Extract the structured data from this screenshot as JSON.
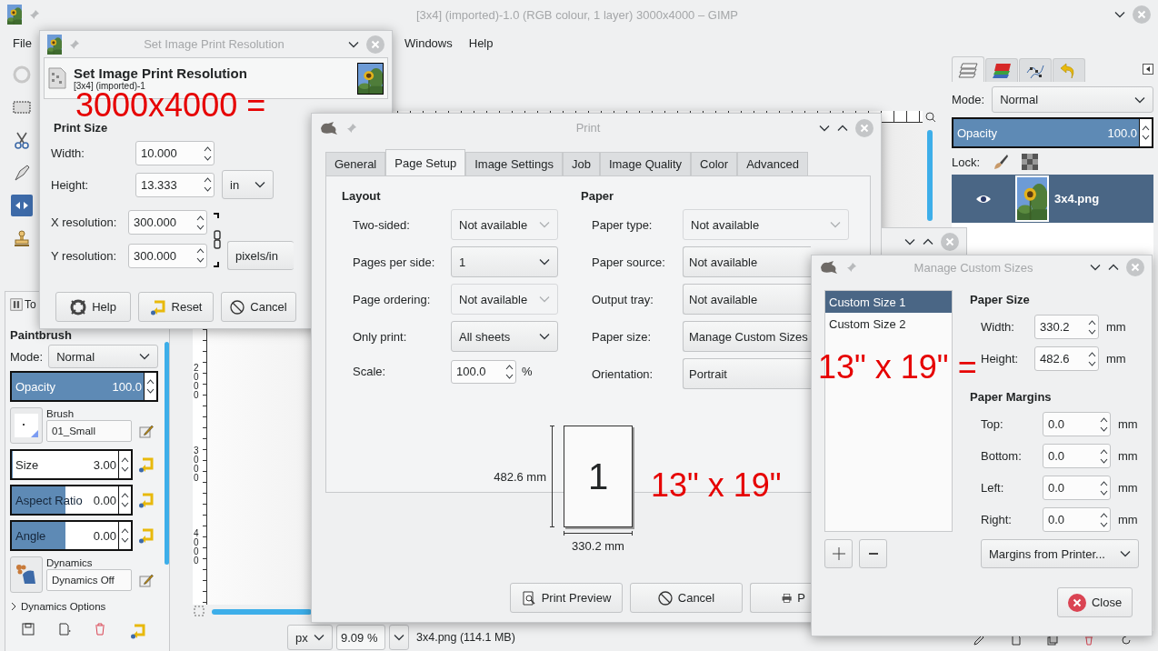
{
  "main_window": {
    "title": "[3x4] (imported)-1.0 (RGB colour, 1 layer) 3000x4000 – GIMP",
    "menu_left": [
      "File"
    ],
    "menu_right": [
      "Windows",
      "Help"
    ]
  },
  "tools": [
    {
      "kind": "ellipse",
      "selected": false
    },
    {
      "kind": "rect",
      "selected": false
    },
    {
      "kind": "scissors",
      "selected": false
    },
    {
      "kind": "pen",
      "selected": false
    },
    {
      "kind": "flip",
      "selected": true
    },
    {
      "kind": "stamp",
      "selected": false
    }
  ],
  "tool_options": {
    "tab": "To",
    "tool": "Paintbrush",
    "mode_label": "Mode:",
    "mode": "Normal",
    "opacity": {
      "label": "Opacity",
      "value": "100.0",
      "level": 1
    },
    "brush": {
      "label": "Brush",
      "value": "01_Small"
    },
    "sliders": [
      {
        "label": "Size",
        "value": "3.00",
        "level": 0.003
      },
      {
        "label": "Aspect Ratio",
        "value": "0.00",
        "level": 0.5
      },
      {
        "label": "Angle",
        "value": "0.00",
        "level": 0.5
      }
    ],
    "dynamics": {
      "label": "Dynamics",
      "value": "Dynamics Off"
    },
    "expander": {
      "label": "Dynamics Options",
      "expanded": false
    }
  },
  "ruler_labels": [
    "2000",
    "3000",
    "4000"
  ],
  "status_bar": {
    "unit": "px",
    "zoom": "9.09 %",
    "info": "3x4.png (114.1 MB)"
  },
  "layers_dock": {
    "tabs": [
      {
        "kind": "layers",
        "selected": true
      },
      {
        "kind": "channels",
        "selected": false
      },
      {
        "kind": "paths",
        "selected": false
      },
      {
        "kind": "undo",
        "selected": false
      }
    ],
    "mode_label": "Mode:",
    "mode": "Normal",
    "opacity": {
      "label": "Opacity",
      "value": "100.0",
      "level": 1
    },
    "lock_label": "Lock:",
    "layers": [
      {
        "name": "3x4.png",
        "visible": true,
        "selected": true
      }
    ]
  },
  "print_resolution_dialog": {
    "title": "Set Image Print Resolution",
    "heading": "Set Image Print Resolution",
    "subtitle": "[3x4] (imported)-1",
    "section": "Print Size",
    "size_fields": [
      {
        "label": "Width:",
        "value": "10.000"
      },
      {
        "label": "Height:",
        "value": "13.333"
      }
    ],
    "size_unit": "in",
    "resolution_fields": [
      {
        "label": "X resolution:",
        "value": "300.000"
      },
      {
        "label": "Y resolution:",
        "value": "300.000"
      }
    ],
    "resolution_unit": "pixels/in",
    "buttons": [
      {
        "label": "Help",
        "kind": "help"
      },
      {
        "label": "Reset",
        "kind": "reset"
      },
      {
        "label": "Cancel",
        "kind": "cancel"
      }
    ]
  },
  "print_dialog": {
    "title": "Print",
    "tabs": [
      {
        "label": "General",
        "selected": false
      },
      {
        "label": "Page Setup",
        "selected": true
      },
      {
        "label": "Image Settings",
        "selected": false
      },
      {
        "label": "Job",
        "selected": false
      },
      {
        "label": "Image Quality",
        "selected": false
      },
      {
        "label": "Color",
        "selected": false
      },
      {
        "label": "Advanced",
        "selected": false
      }
    ],
    "layout": {
      "heading": "Layout",
      "rows": [
        {
          "label": "Two-sided:",
          "value": "Not available",
          "disabled": true
        },
        {
          "label": "Pages per side:",
          "value": "1",
          "disabled": false
        },
        {
          "label": "Page ordering:",
          "value": "Not available",
          "disabled": true
        },
        {
          "label": "Only print:",
          "value": "All sheets",
          "disabled": false
        }
      ],
      "scale": {
        "label": "Scale:",
        "value": "100.0",
        "unit": "%"
      }
    },
    "paper": {
      "heading": "Paper",
      "rows": [
        {
          "label": "Paper type:",
          "value": "Not available",
          "disabled": true
        },
        {
          "label": "Paper source:",
          "value": "Not available"
        },
        {
          "label": "Output tray:",
          "value": "Not available"
        },
        {
          "label": "Paper size:",
          "value": "Manage Custom Sizes"
        },
        {
          "label": "Orientation:",
          "value": "Portrait"
        }
      ]
    },
    "preview": {
      "page_number": "1",
      "height_label": "482.6 mm",
      "width_label": "330.2 mm"
    },
    "buttons": [
      {
        "label": "Print Preview",
        "kind": "preview"
      },
      {
        "label": "Cancel",
        "kind": "cancel"
      },
      {
        "label": "P",
        "kind": "print"
      }
    ]
  },
  "manage_sizes_dialog": {
    "title": "Manage Custom Sizes",
    "sizes": [
      {
        "name": "Custom Size 1",
        "selected": true
      },
      {
        "name": "Custom Size 2",
        "selected": false
      }
    ],
    "size_heading": "Paper Size",
    "size_fields": [
      {
        "label": "Width:",
        "value": "330.2",
        "unit": "mm"
      },
      {
        "label": "Height:",
        "value": "482.6",
        "unit": "mm"
      }
    ],
    "margins_heading": "Paper Margins",
    "margin_fields": [
      {
        "label": "Top:",
        "value": "0.0",
        "unit": "mm"
      },
      {
        "label": "Bottom:",
        "value": "0.0",
        "unit": "mm"
      },
      {
        "label": "Left:",
        "value": "0.0",
        "unit": "mm"
      },
      {
        "label": "Right:",
        "value": "0.0",
        "unit": "mm"
      }
    ],
    "margins_button": "Margins from Printer...",
    "close_button": "Close"
  },
  "annotations": [
    {
      "text": "3000x4000 ="
    },
    {
      "text": "13\" x 19\" ="
    },
    {
      "text": "13\" x 19\""
    }
  ]
}
